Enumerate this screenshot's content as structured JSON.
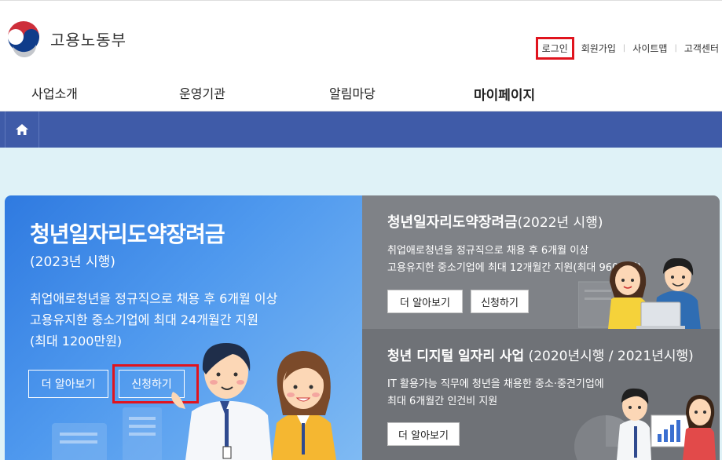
{
  "header": {
    "logo_text": "고용노동부",
    "util": {
      "login": "로그인",
      "signup": "회원가입",
      "sitemap": "사이트맵",
      "support": "고객센터"
    }
  },
  "gnb": {
    "items": [
      "사업소개",
      "운영기관",
      "알림마당",
      "마이페이지"
    ]
  },
  "main_banner": {
    "title": "청년일자리도약장려금",
    "subtitle": "(2023년 시행)",
    "desc_line1": "취업애로청년을 정규직으로 채용 후 6개월 이상",
    "desc_line2": "고용유지한 중소기업에 최대 24개월간 지원",
    "desc_line3": "(최대 1200만원)",
    "more_label": "더 알아보기",
    "apply_label": "신청하기"
  },
  "top_right": {
    "title": "청년일자리도약장려금",
    "title_suffix": "(2022년 시행)",
    "desc_line1": "취업애로청년을 정규직으로 채용 후 6개월 이상",
    "desc_line2": "고용유지한 중소기업에 최대 12개월간 지원(최대 960만원)",
    "more_label": "더 알아보기",
    "apply_label": "신청하기"
  },
  "bottom_right": {
    "title": "청년 디지털 일자리 사업",
    "title_suffix": "(2020년시행 / 2021년시행)",
    "desc_line1": "IT 활용가능 직무에 청년을 채용한 중소·중견기업에",
    "desc_line2": "최대 6개월간 인건비 지원",
    "more_label": "더 알아보기"
  },
  "colors": {
    "brand_blue": "#3f5ba8",
    "highlight_red": "#e0141e",
    "main_bg": "#dff2f7"
  },
  "icons": {
    "home": "home-icon",
    "logo": "taegeuk-logo-icon"
  }
}
